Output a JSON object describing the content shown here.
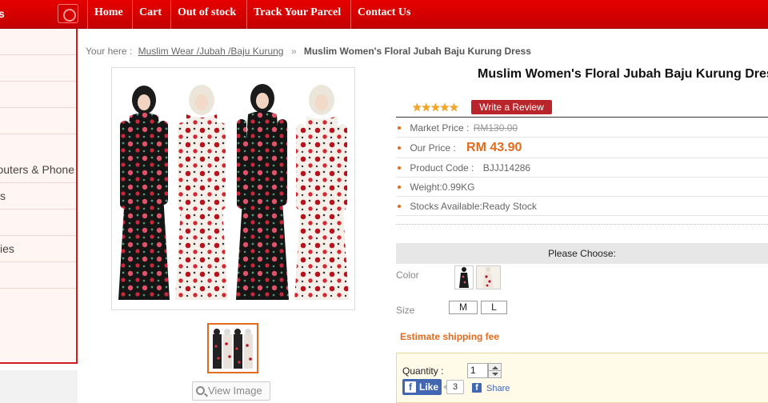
{
  "nav": {
    "edge_glyph": "s",
    "items": [
      "Home",
      "Cart",
      "Out of stock",
      "Track Your Parcel",
      "Contact Us"
    ]
  },
  "sidebar": {
    "items": [
      "",
      "",
      "",
      "",
      "outers & Phone",
      "s",
      "",
      "ies",
      ""
    ]
  },
  "breadcrumb": {
    "prefix": "Your here :",
    "category": "Muslim Wear /Jubah /Baju Kurung",
    "separator": "»",
    "current": "Muslim Women's Floral Jubah Baju Kurung Dress"
  },
  "product": {
    "title": "Muslim Women's Floral Jubah Baju Kurung Dress",
    "rating_stars": "★★★★★",
    "review_button": "Write a Review",
    "market_price_label": "Market Price :",
    "market_price": "RM130.00",
    "our_price_label": "Our Price :",
    "our_price": "RM 43.90",
    "product_code_label": "Product Code :",
    "product_code": "BJJJ14286",
    "weight": "Weight:0.99KG",
    "stock": "Stocks Available:Ready Stock"
  },
  "options": {
    "please_choose": "Please Choose:",
    "color_label": "Color",
    "size_label": "Size",
    "sizes": [
      "M",
      "L"
    ],
    "shipping": "Estimate shipping fee"
  },
  "purchase": {
    "quantity_label": "Quantity :",
    "quantity_value": "1"
  },
  "social": {
    "like_label": "Like",
    "like_count": "3",
    "share_label": "Share"
  },
  "gallery": {
    "view_image": "View Image"
  },
  "colors": {
    "nav_red": "#d40000",
    "accent_orange": "#e36b1d",
    "review_red": "#b8262b",
    "facebook_blue": "#4267b2"
  }
}
